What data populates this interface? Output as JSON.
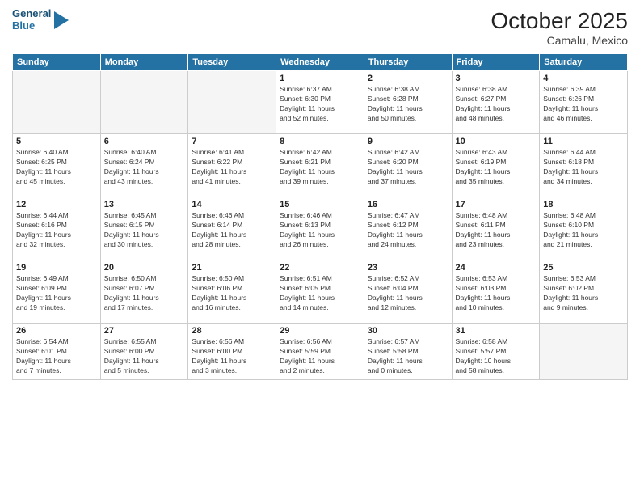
{
  "header": {
    "logo_line1": "General",
    "logo_line2": "Blue",
    "month": "October 2025",
    "location": "Camalu, Mexico"
  },
  "weekdays": [
    "Sunday",
    "Monday",
    "Tuesday",
    "Wednesday",
    "Thursday",
    "Friday",
    "Saturday"
  ],
  "days": [
    {
      "num": "",
      "info": ""
    },
    {
      "num": "",
      "info": ""
    },
    {
      "num": "",
      "info": ""
    },
    {
      "num": "1",
      "info": "Sunrise: 6:37 AM\nSunset: 6:30 PM\nDaylight: 11 hours\nand 52 minutes."
    },
    {
      "num": "2",
      "info": "Sunrise: 6:38 AM\nSunset: 6:28 PM\nDaylight: 11 hours\nand 50 minutes."
    },
    {
      "num": "3",
      "info": "Sunrise: 6:38 AM\nSunset: 6:27 PM\nDaylight: 11 hours\nand 48 minutes."
    },
    {
      "num": "4",
      "info": "Sunrise: 6:39 AM\nSunset: 6:26 PM\nDaylight: 11 hours\nand 46 minutes."
    },
    {
      "num": "5",
      "info": "Sunrise: 6:40 AM\nSunset: 6:25 PM\nDaylight: 11 hours\nand 45 minutes."
    },
    {
      "num": "6",
      "info": "Sunrise: 6:40 AM\nSunset: 6:24 PM\nDaylight: 11 hours\nand 43 minutes."
    },
    {
      "num": "7",
      "info": "Sunrise: 6:41 AM\nSunset: 6:22 PM\nDaylight: 11 hours\nand 41 minutes."
    },
    {
      "num": "8",
      "info": "Sunrise: 6:42 AM\nSunset: 6:21 PM\nDaylight: 11 hours\nand 39 minutes."
    },
    {
      "num": "9",
      "info": "Sunrise: 6:42 AM\nSunset: 6:20 PM\nDaylight: 11 hours\nand 37 minutes."
    },
    {
      "num": "10",
      "info": "Sunrise: 6:43 AM\nSunset: 6:19 PM\nDaylight: 11 hours\nand 35 minutes."
    },
    {
      "num": "11",
      "info": "Sunrise: 6:44 AM\nSunset: 6:18 PM\nDaylight: 11 hours\nand 34 minutes."
    },
    {
      "num": "12",
      "info": "Sunrise: 6:44 AM\nSunset: 6:16 PM\nDaylight: 11 hours\nand 32 minutes."
    },
    {
      "num": "13",
      "info": "Sunrise: 6:45 AM\nSunset: 6:15 PM\nDaylight: 11 hours\nand 30 minutes."
    },
    {
      "num": "14",
      "info": "Sunrise: 6:46 AM\nSunset: 6:14 PM\nDaylight: 11 hours\nand 28 minutes."
    },
    {
      "num": "15",
      "info": "Sunrise: 6:46 AM\nSunset: 6:13 PM\nDaylight: 11 hours\nand 26 minutes."
    },
    {
      "num": "16",
      "info": "Sunrise: 6:47 AM\nSunset: 6:12 PM\nDaylight: 11 hours\nand 24 minutes."
    },
    {
      "num": "17",
      "info": "Sunrise: 6:48 AM\nSunset: 6:11 PM\nDaylight: 11 hours\nand 23 minutes."
    },
    {
      "num": "18",
      "info": "Sunrise: 6:48 AM\nSunset: 6:10 PM\nDaylight: 11 hours\nand 21 minutes."
    },
    {
      "num": "19",
      "info": "Sunrise: 6:49 AM\nSunset: 6:09 PM\nDaylight: 11 hours\nand 19 minutes."
    },
    {
      "num": "20",
      "info": "Sunrise: 6:50 AM\nSunset: 6:07 PM\nDaylight: 11 hours\nand 17 minutes."
    },
    {
      "num": "21",
      "info": "Sunrise: 6:50 AM\nSunset: 6:06 PM\nDaylight: 11 hours\nand 16 minutes."
    },
    {
      "num": "22",
      "info": "Sunrise: 6:51 AM\nSunset: 6:05 PM\nDaylight: 11 hours\nand 14 minutes."
    },
    {
      "num": "23",
      "info": "Sunrise: 6:52 AM\nSunset: 6:04 PM\nDaylight: 11 hours\nand 12 minutes."
    },
    {
      "num": "24",
      "info": "Sunrise: 6:53 AM\nSunset: 6:03 PM\nDaylight: 11 hours\nand 10 minutes."
    },
    {
      "num": "25",
      "info": "Sunrise: 6:53 AM\nSunset: 6:02 PM\nDaylight: 11 hours\nand 9 minutes."
    },
    {
      "num": "26",
      "info": "Sunrise: 6:54 AM\nSunset: 6:01 PM\nDaylight: 11 hours\nand 7 minutes."
    },
    {
      "num": "27",
      "info": "Sunrise: 6:55 AM\nSunset: 6:00 PM\nDaylight: 11 hours\nand 5 minutes."
    },
    {
      "num": "28",
      "info": "Sunrise: 6:56 AM\nSunset: 6:00 PM\nDaylight: 11 hours\nand 3 minutes."
    },
    {
      "num": "29",
      "info": "Sunrise: 6:56 AM\nSunset: 5:59 PM\nDaylight: 11 hours\nand 2 minutes."
    },
    {
      "num": "30",
      "info": "Sunrise: 6:57 AM\nSunset: 5:58 PM\nDaylight: 11 hours\nand 0 minutes."
    },
    {
      "num": "31",
      "info": "Sunrise: 6:58 AM\nSunset: 5:57 PM\nDaylight: 10 hours\nand 58 minutes."
    },
    {
      "num": "",
      "info": ""
    }
  ]
}
